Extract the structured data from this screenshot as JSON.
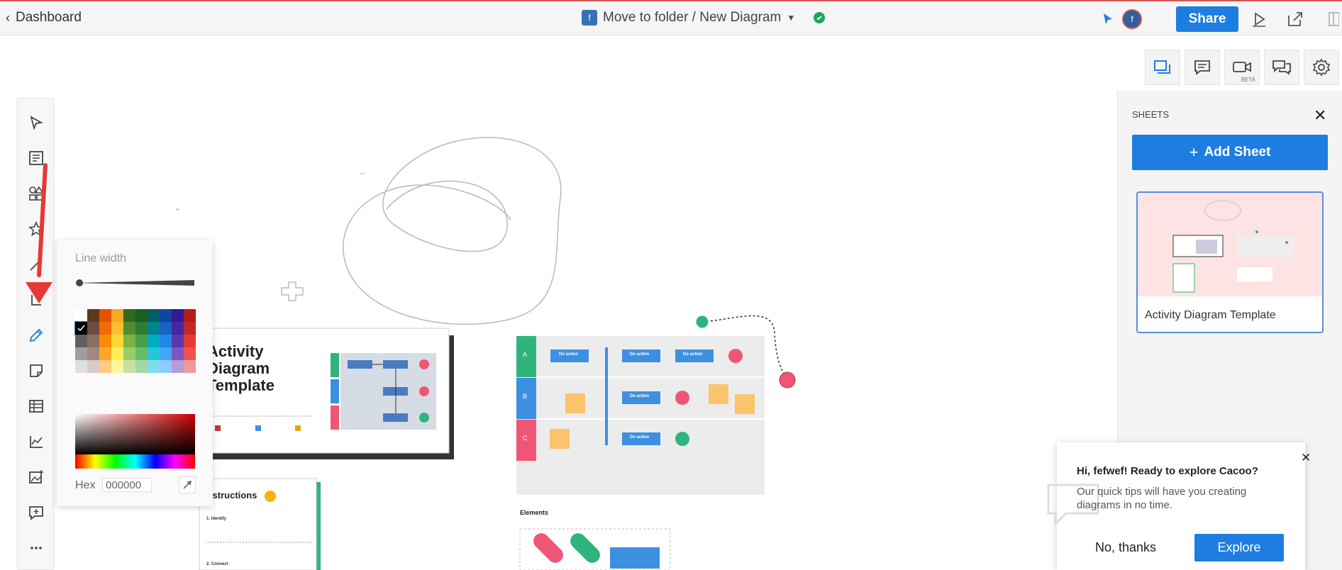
{
  "topbar": {
    "back_label": "Dashboard",
    "user_initial": "f",
    "breadcrumb": "Move to folder / New Diagram",
    "share_label": "Share"
  },
  "right_tools": {
    "icons": [
      "sheets-icon",
      "comments-icon",
      "video-icon",
      "chat-icon",
      "gear-icon"
    ],
    "video_badge": "BETA"
  },
  "left_toolbar": {
    "icons": [
      "pointer-icon",
      "text-icon",
      "shapes-icon",
      "star-icon",
      "connector-icon",
      "pen-icon",
      "sticky-note-icon",
      "table-icon",
      "chart-icon",
      "image-icon",
      "add-comment-icon",
      "more-icon"
    ],
    "active": "pen-icon"
  },
  "line_popup": {
    "line_width_label": "Line width",
    "hex_label": "Hex",
    "hex_value": "000000",
    "palette": [
      [
        "#ffffff",
        "#5d3a1a",
        "#e65100",
        "#f9a825",
        "#33691e",
        "#1b5e20",
        "#006064",
        "#0d47a1",
        "#311b92",
        "#b71c1c"
      ],
      [
        "#000000",
        "#6d4c41",
        "#ef6c00",
        "#fbc02d",
        "#558b2f",
        "#2e7d32",
        "#00838f",
        "#1565c0",
        "#4527a0",
        "#c62828"
      ],
      [
        "#616161",
        "#8d6e63",
        "#fb8c00",
        "#fdd835",
        "#7cb342",
        "#43a047",
        "#00acc1",
        "#1e88e5",
        "#5e35b1",
        "#e53935"
      ],
      [
        "#9e9e9e",
        "#a1887f",
        "#ffa726",
        "#ffee58",
        "#9ccc65",
        "#66bb6a",
        "#26c6da",
        "#42a5f5",
        "#7e57c2",
        "#ef5350"
      ],
      [
        "#e0e0e0",
        "#d7ccc8",
        "#ffcc80",
        "#fff59d",
        "#c5e1a5",
        "#a5d6a7",
        "#80deea",
        "#90caf9",
        "#b39ddb",
        "#ef9a9a"
      ]
    ]
  },
  "canvas": {
    "activity_title": [
      "Activity",
      "Diagram",
      "Template"
    ],
    "instructions_title": "Instructions",
    "step1": "1. Identify",
    "step2": "2. Connect",
    "elements_label": "Elements",
    "lanes": [
      "A",
      "B",
      "C"
    ],
    "do_action": "Do action",
    "lane_colors": [
      "#2fb47e",
      "#3d8fe0",
      "#ef5675"
    ]
  },
  "sheets_panel": {
    "title": "SHEETS",
    "add_label": "Add Sheet",
    "sheet_name": "Activity Diagram Template"
  },
  "tip": {
    "title": "Hi, fefwef! Ready to explore Cacoo?",
    "body": "Our quick tips will have you creating diagrams in no time.",
    "no_label": "No, thanks",
    "explore_label": "Explore"
  }
}
